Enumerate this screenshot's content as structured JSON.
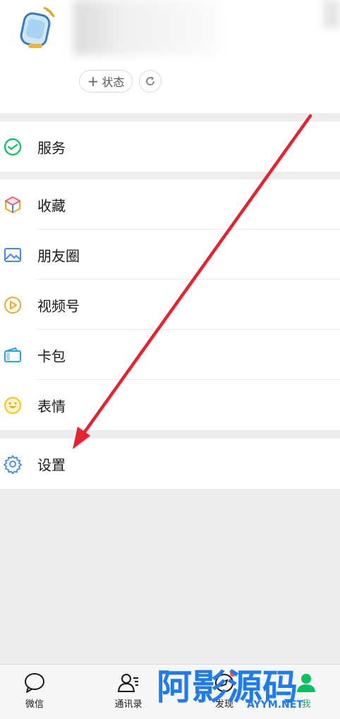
{
  "profile": {
    "status_label": "状态",
    "status_plus": "+"
  },
  "groups": [
    {
      "items": [
        {
          "label": "服务",
          "icon": "wechat-pay-icon"
        }
      ]
    },
    {
      "items": [
        {
          "label": "收藏",
          "icon": "favorites-cube-icon"
        },
        {
          "label": "朋友圈",
          "icon": "moments-image-icon"
        },
        {
          "label": "视频号",
          "icon": "channels-play-icon"
        },
        {
          "label": "卡包",
          "icon": "card-wallet-icon"
        },
        {
          "label": "表情",
          "icon": "smiley-icon"
        }
      ]
    },
    {
      "items": [
        {
          "label": "设置",
          "icon": "gear-icon"
        }
      ]
    }
  ],
  "tabbar": {
    "tabs": [
      {
        "label": "微信",
        "icon": "chat-bubble-icon"
      },
      {
        "label": "通讯录",
        "icon": "contacts-icon"
      },
      {
        "label": "发现",
        "icon": "discover-compass-icon"
      },
      {
        "label": "我",
        "icon": "me-person-icon"
      }
    ],
    "active": "我"
  },
  "watermark": {
    "main": "阿影源码",
    "sub": "AYYM.NET"
  },
  "colors": {
    "accent_green": "#07c160",
    "arrow_red": "#e8212e",
    "badge_red": "#fa5151",
    "background": "#ededed"
  }
}
